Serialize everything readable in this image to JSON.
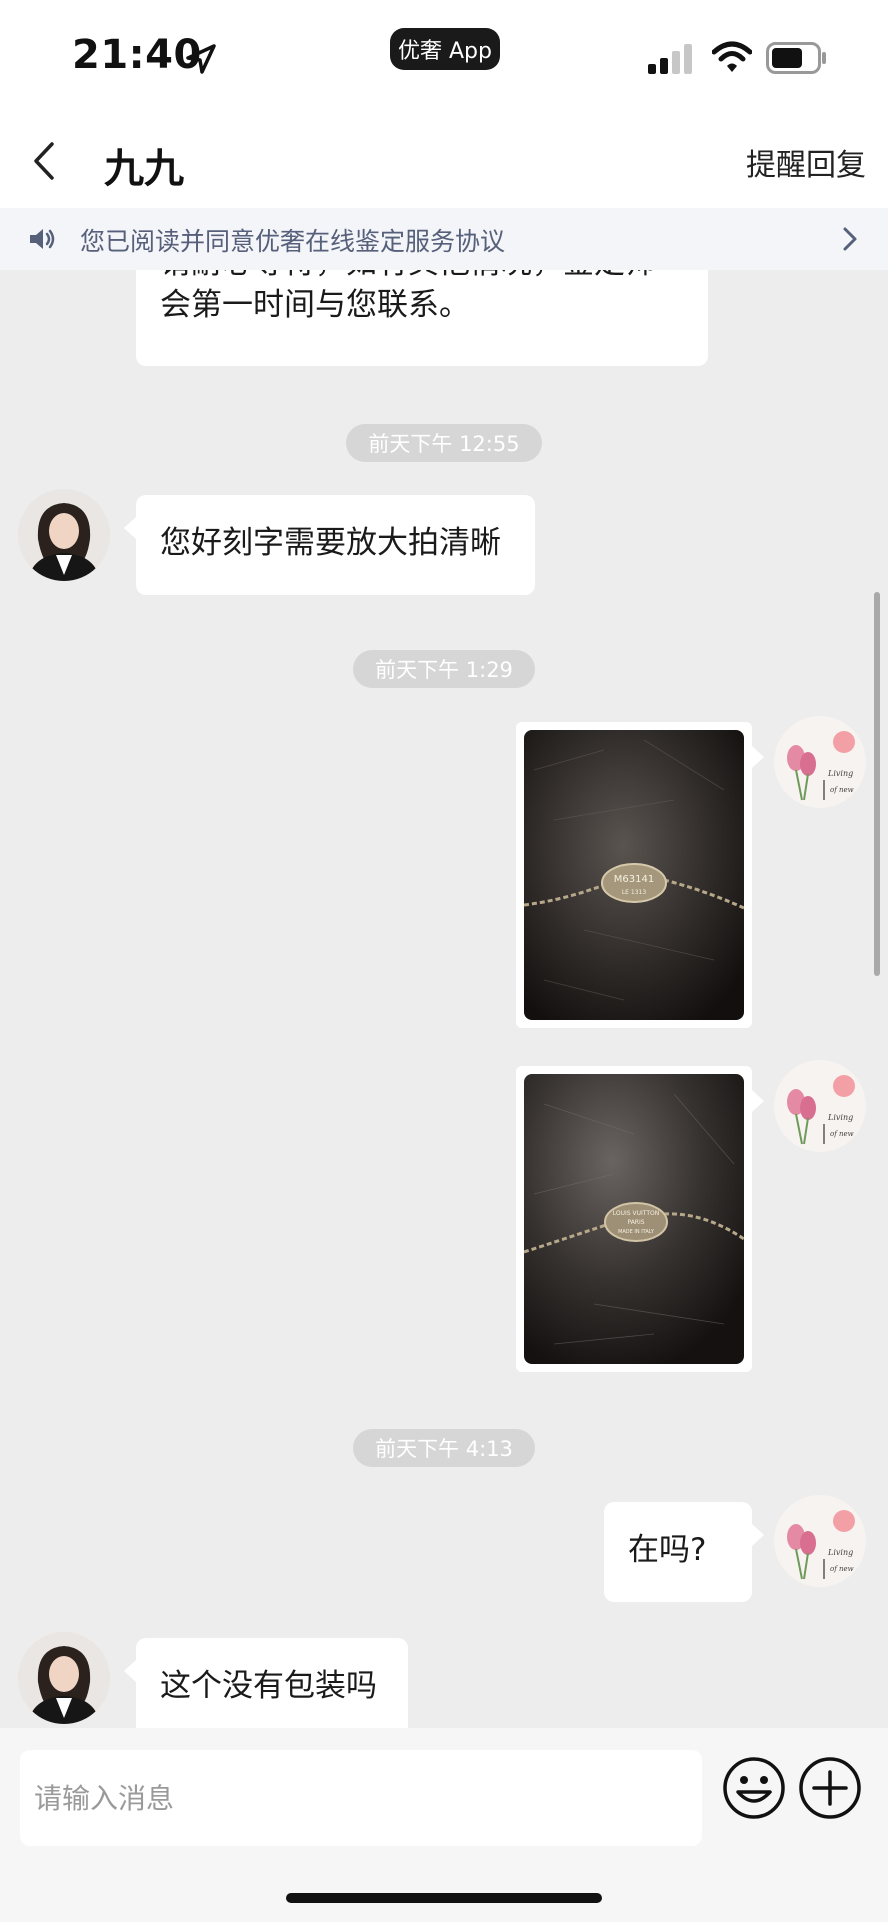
{
  "status_bar": {
    "time": "21:40",
    "app_pill": "优奢 App"
  },
  "nav": {
    "title": "九九",
    "remind_label": "提醒回复"
  },
  "notice": {
    "text": "您已阅读并同意优奢在线鉴定服务协议"
  },
  "messages": {
    "partial": {
      "line1": "请耐心等待，如有其他情况，鉴定师",
      "line2": "会第一时间与您联系。"
    },
    "ts1": "前天下午 12:55",
    "msg1": "您好刻字需要放大拍清晰",
    "ts2": "前天下午 1:29",
    "image1": {
      "engraving_line1": "M63141",
      "engraving_line2": "LE 1313"
    },
    "image2": {
      "engraving_line1": "LOUIS VUITTON",
      "engraving_line2": "PARIS",
      "engraving_line3": "MADE IN ITALY"
    },
    "ts3": "前天下午 4:13",
    "msg2": "在吗?",
    "msg3": "这个没有包装吗"
  },
  "avatar_user_text": {
    "line1": "Living",
    "line2": "of new"
  },
  "input": {
    "placeholder": "请输入消息"
  },
  "colors": {
    "chat_bg": "#ededed",
    "bubble_bg": "#ffffff",
    "timestamp_bg": "#d6d6d6",
    "notice_text": "#56607a"
  }
}
